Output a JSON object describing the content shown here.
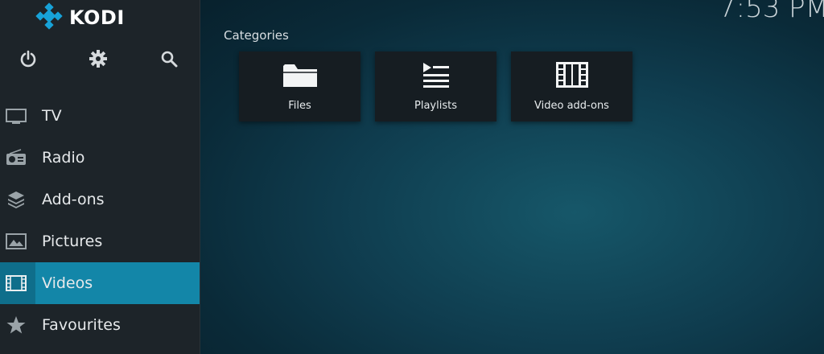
{
  "app": {
    "logo_text": "KODI"
  },
  "header": {
    "clock": "7:53 PM"
  },
  "top_icons": [
    {
      "name": "power-icon"
    },
    {
      "name": "gear-icon"
    },
    {
      "name": "search-icon"
    }
  ],
  "menu": {
    "items": [
      {
        "label": "TV",
        "icon": "tv-icon"
      },
      {
        "label": "Radio",
        "icon": "radio-icon"
      },
      {
        "label": "Add-ons",
        "icon": "addons-icon"
      },
      {
        "label": "Pictures",
        "icon": "pictures-icon"
      },
      {
        "label": "Videos",
        "icon": "film-icon",
        "active": true
      },
      {
        "label": "Favourites",
        "icon": "star-icon"
      }
    ]
  },
  "main": {
    "section_title": "Categories",
    "tiles": [
      {
        "label": "Files",
        "icon": "folder-icon"
      },
      {
        "label": "Playlists",
        "icon": "playlist-icon"
      },
      {
        "label": "Video add-ons",
        "icon": "film-strip-icon"
      }
    ]
  },
  "colors": {
    "accent": "#1386a8",
    "sidebar_bg": "#1d2429",
    "tile_bg": "#161d22"
  }
}
